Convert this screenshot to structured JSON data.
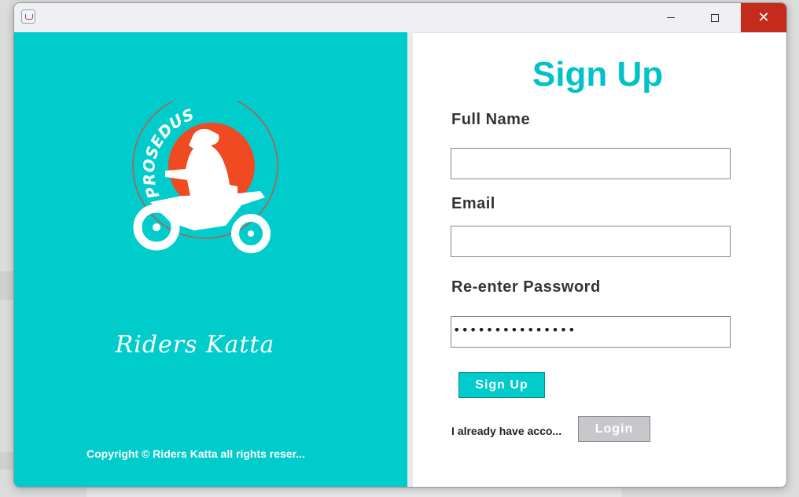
{
  "window": {
    "title": "",
    "buttons": {
      "minimize_icon": "minimize-icon",
      "maximize_icon": "maximize-icon",
      "close_icon": "close-icon"
    }
  },
  "left_panel": {
    "logo_text": "PROSEDUS",
    "brand_name": "Riders Katta",
    "copyright": "Copyright © Riders Katta all rights reser..."
  },
  "form": {
    "title": "Sign Up",
    "full_name_label": "Full Name",
    "full_name_value": "",
    "email_label": "Email",
    "email_value": "",
    "password_label": "Re-enter Password",
    "password_mask": "•••••••••••••••",
    "signup_button": "Sign Up",
    "have_account_text": "I already have acco...",
    "login_button": "Login"
  },
  "colors": {
    "accent": "#00cccc",
    "title": "#00c2c8",
    "logo_sun": "#f04a22",
    "close_button": "#c42b1c",
    "login_button_bg": "#c8c8cc"
  }
}
